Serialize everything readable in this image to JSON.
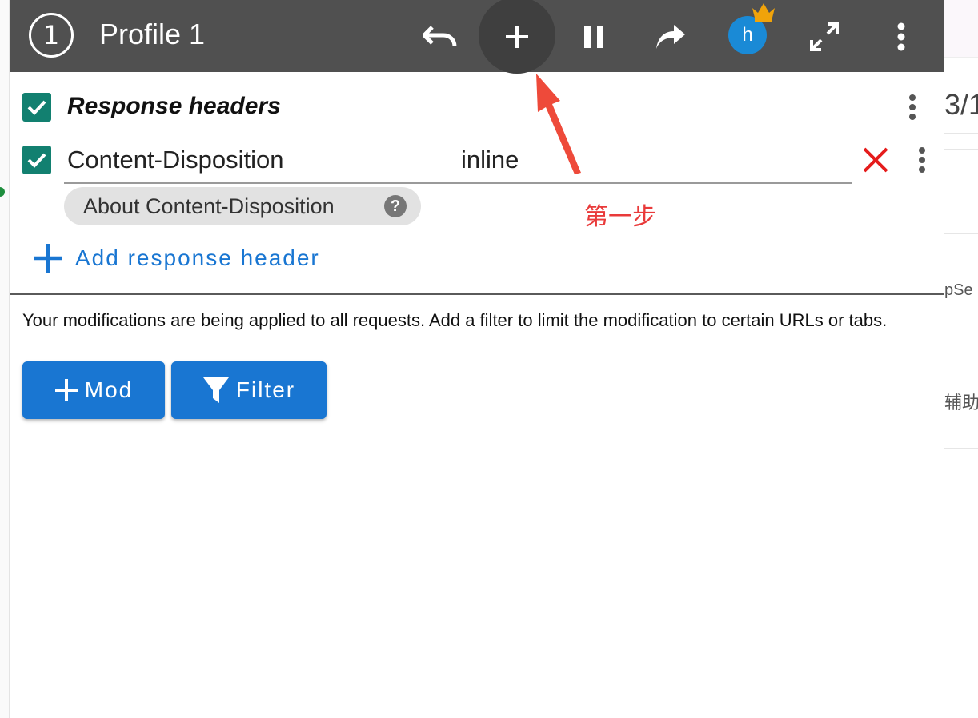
{
  "toolbar": {
    "profile_number": "1",
    "profile_title": "Profile 1",
    "avatar_initial": "h"
  },
  "section": {
    "title": "Response headers",
    "checked": true
  },
  "header_row": {
    "name": "Content-Disposition",
    "value": "inline",
    "checked": true,
    "help_chip": "About Content-Disposition",
    "help_glyph": "?"
  },
  "add_header_label": "Add response header",
  "notice": "Your modifications are being applied to all requests. Add a filter to limit the modification to certain URLs or tabs.",
  "buttons": {
    "mod_label": "Mod",
    "filter_label": "Filter"
  },
  "annotation": {
    "text": "第一步",
    "color": "#e93a3a"
  },
  "background_page": {
    "fragment_1": "3/1",
    "fragment_2": "pSe",
    "fragment_3": "辅助"
  },
  "colors": {
    "toolbar": "#505050",
    "accent": "#1976d2",
    "checkbox": "#128070",
    "remove": "#e51c1c",
    "avatar": "#1a8ad6",
    "crown": "#f0a30a"
  }
}
